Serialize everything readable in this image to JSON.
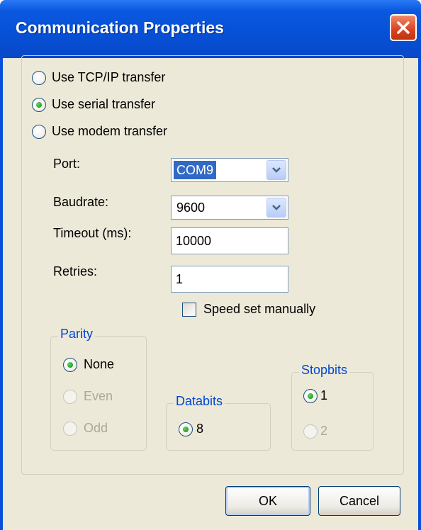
{
  "window": {
    "title": "Communication Properties"
  },
  "transfer": {
    "tcpip_label": "Use TCP/IP transfer",
    "serial_label": "Use serial transfer",
    "modem_label": "Use modem transfer"
  },
  "port": {
    "label": "Port:",
    "value": "COM9"
  },
  "baudrate": {
    "label": "Baudrate:",
    "value": "9600"
  },
  "timeout": {
    "label": "Timeout (ms):",
    "value": "10000"
  },
  "retries": {
    "label": "Retries:",
    "value": "1"
  },
  "speed_manual": {
    "label": "Speed set manually",
    "checked": false
  },
  "parity": {
    "title": "Parity",
    "none": "None",
    "even": "Even",
    "odd": "Odd"
  },
  "databits": {
    "title": "Databits",
    "value": "8"
  },
  "stopbits": {
    "title": "Stopbits",
    "one": "1",
    "two": "2"
  },
  "buttons": {
    "ok": "OK",
    "cancel": "Cancel"
  },
  "colors": {
    "titlebar": "#0650d6",
    "dialog_bg": "#ece9d8",
    "group_title": "#0046d5",
    "selection": "#316ac5"
  }
}
